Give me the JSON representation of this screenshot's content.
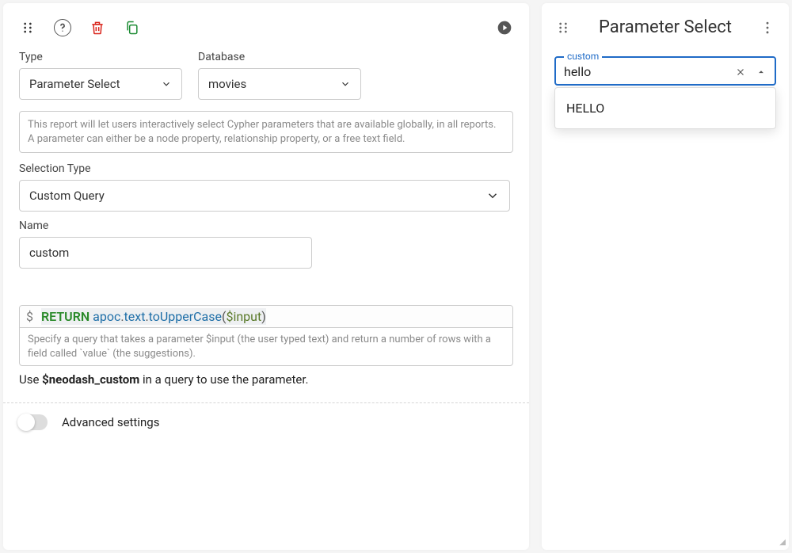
{
  "leftPanel": {
    "typeLabel": "Type",
    "typeValue": "Parameter Select",
    "dbLabel": "Database",
    "dbValue": "movies",
    "descText": "This report will let users interactively select Cypher parameters that are available globally, in all reports. A parameter can either be a node property, relationship property, or a free text field.",
    "selTypeLabel": "Selection Type",
    "selTypeValue": "Custom Query",
    "nameLabel": "Name",
    "nameValue": "custom",
    "query": {
      "prompt": "$",
      "text": "RETURN apoc.text.toUpperCase($input)",
      "keyword": "RETURN",
      "ns1": "apoc",
      "ns2": "text",
      "fn": "toUpperCase",
      "param": "$input",
      "help": "Specify a query that takes a parameter $input (the user typed text) and return a number of rows with a field called `value` (the suggestions)."
    },
    "usagePrefix": "Use ",
    "usageVar": "$neodash_custom",
    "usageSuffix": " in a query to use the parameter.",
    "advLabel": "Advanced settings",
    "advOn": false
  },
  "rightPanel": {
    "title": "Parameter Select",
    "combo": {
      "label": "custom",
      "value": "hello"
    },
    "options": [
      "HELLO"
    ]
  }
}
